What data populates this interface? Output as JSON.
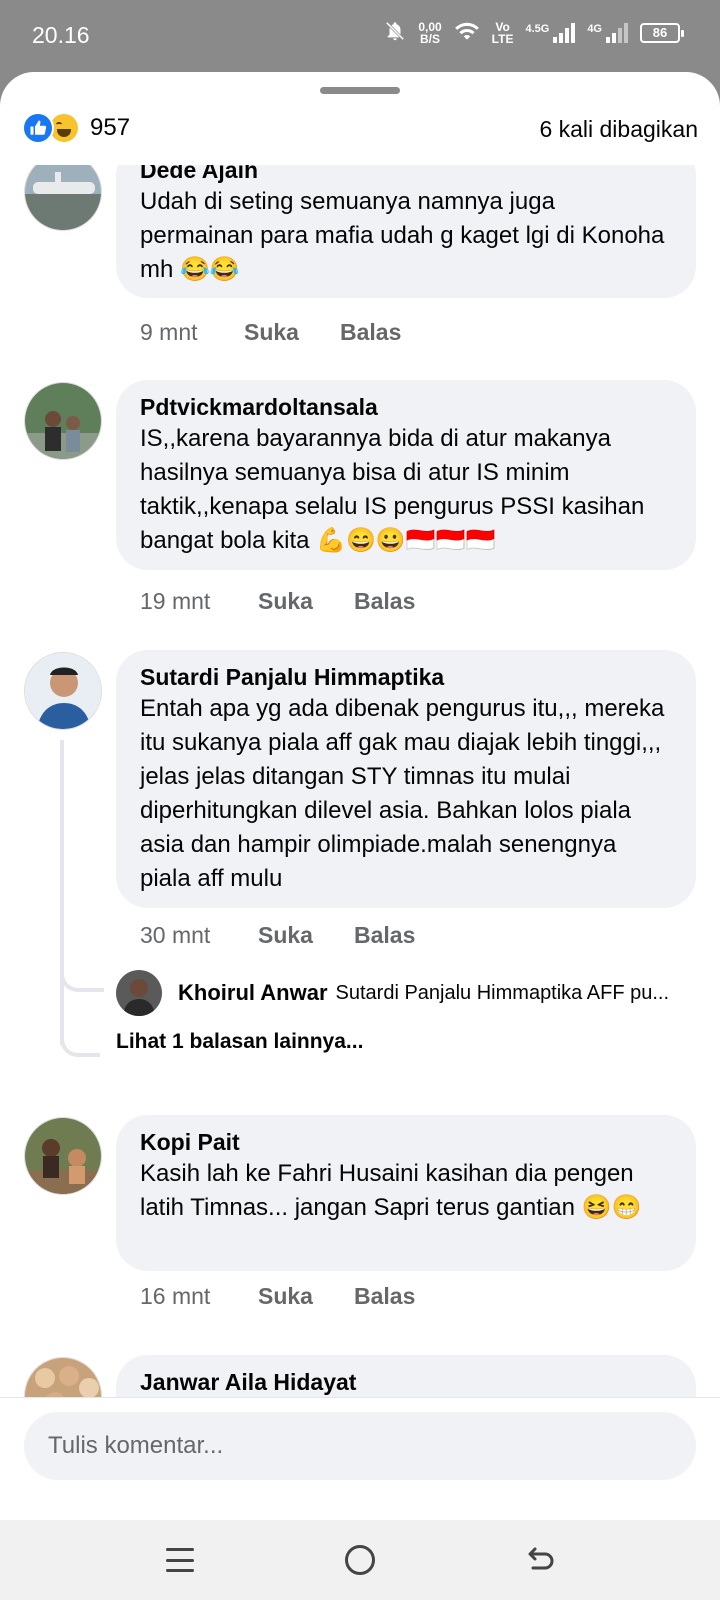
{
  "status_bar": {
    "time": "20.16",
    "net_speed_top": "0,00",
    "net_speed_bottom": "B/S",
    "volte_top": "Vo",
    "volte_bottom": "LTE",
    "net1": "4.5G",
    "net2": "4G",
    "battery": "86"
  },
  "header": {
    "reaction_count": "957",
    "share_count": "6 kali dibagikan"
  },
  "comments": [
    {
      "author": "Dede Ajaih",
      "text": "Udah di seting semuanya namnya juga permainan para mafia udah g kaget lgi di Konoha mh 😂😂",
      "time": "9 mnt",
      "like": "Suka",
      "reply": "Balas"
    },
    {
      "author": "Pdtvickmardoltansala",
      "text": "IS,,karena bayarannya bida di atur makanya hasilnya semuanya bisa di atur IS minim taktik,,kenapa selalu IS pengurus PSSI kasihan bangat bola kita 💪😄😀🇮🇩🇮🇩🇮🇩",
      "time": "19 mnt",
      "like": "Suka",
      "reply": "Balas"
    },
    {
      "author": "Sutardi Panjalu Himmaptika",
      "text": "Entah apa yg ada dibenak pengurus itu,,, mereka itu sukanya piala aff gak mau diajak lebih tinggi,,, jelas jelas ditangan STY timnas itu mulai diperhitungkan dilevel asia. Bahkan lolos piala asia dan hampir olimpiade.malah senengnya piala aff mulu",
      "time": "30 mnt",
      "like": "Suka",
      "reply": "Balas",
      "reply_preview": {
        "author": "Khoirul Anwar",
        "text": "Sutardi Panjalu Himmaptika AFF pu..."
      },
      "more_replies": "Lihat 1 balasan lainnya..."
    },
    {
      "author": "Kopi Pait",
      "text": "Kasih lah ke Fahri Husaini kasihan dia pengen latih Timnas... jangan Sapri terus gantian 😆😁",
      "time": "16 mnt",
      "like": "Suka",
      "reply": "Balas"
    },
    {
      "author": "Janwar Aila Hidayat",
      "text": ""
    }
  ],
  "composer": {
    "placeholder": "Tulis komentar..."
  },
  "colors": {
    "like_blue": "#1877f2",
    "bubble_bg": "#f0f2f5",
    "meta_gray": "#65676b",
    "status_bg": "#8a8a8a"
  },
  "icons": [
    "notifications-off-icon",
    "wifi-icon",
    "signal-icon",
    "battery-icon",
    "like-reaction-icon",
    "haha-reaction-icon",
    "menu-icon",
    "home-icon",
    "back-icon"
  ]
}
